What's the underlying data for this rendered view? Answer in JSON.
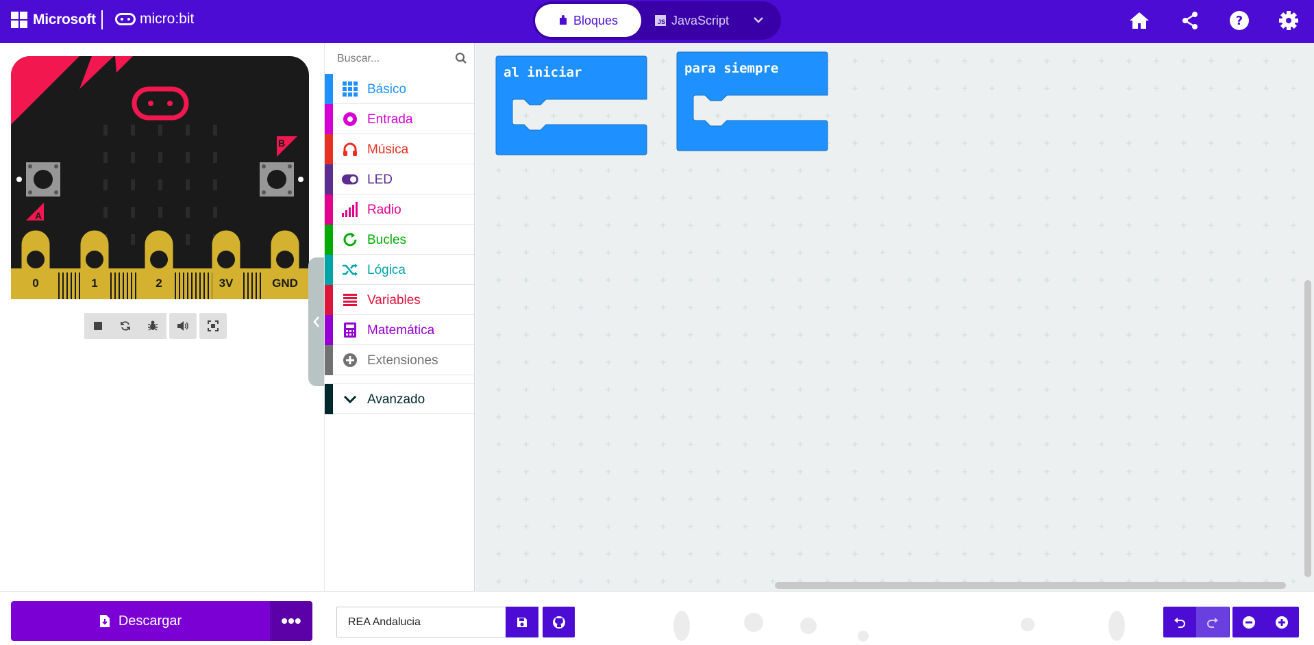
{
  "header": {
    "brand": "Microsoft",
    "product": "micro:bit",
    "tabs": [
      {
        "label": "Bloques",
        "active": true
      },
      {
        "label": "JavaScript",
        "active": false
      }
    ],
    "js_badge": "JS",
    "icons": [
      "home-icon",
      "share-icon",
      "help-icon",
      "settings-icon"
    ]
  },
  "simulator": {
    "pins": [
      "0",
      "1",
      "2",
      "3V",
      "GND"
    ],
    "button_a": "A",
    "button_b": "B",
    "toolbar_icons": [
      "stop-icon",
      "restart-icon",
      "debug-icon",
      "sound-icon",
      "fullscreen-icon"
    ]
  },
  "toolbox": {
    "search_placeholder": "Buscar...",
    "categories": [
      {
        "label": "Básico",
        "color": "#1e90ff",
        "icon": "grid-icon"
      },
      {
        "label": "Entrada",
        "color": "#d400d4",
        "icon": "target-icon"
      },
      {
        "label": "Música",
        "color": "#e63022",
        "icon": "headphones-icon"
      },
      {
        "label": "LED",
        "color": "#5c2d91",
        "icon": "toggle-icon"
      },
      {
        "label": "Radio",
        "color": "#e3008c",
        "icon": "signal-icon"
      },
      {
        "label": "Bucles",
        "color": "#00aa00",
        "icon": "loop-icon"
      },
      {
        "label": "Lógica",
        "color": "#00a4a6",
        "icon": "shuffle-icon"
      },
      {
        "label": "Variables",
        "color": "#dc143c",
        "icon": "list-icon"
      },
      {
        "label": "Matemática",
        "color": "#9400d3",
        "icon": "calculator-icon"
      },
      {
        "label": "Extensiones",
        "color": "#717171",
        "icon": "plus-circle-icon"
      },
      {
        "label": "Avanzado",
        "color": "#00272b",
        "icon": "chevron-down-icon"
      }
    ]
  },
  "workspace": {
    "blocks": [
      {
        "label": "al iniciar"
      },
      {
        "label": "para siempre"
      }
    ],
    "block_color": "#1e90ff"
  },
  "footer": {
    "download_label": "Descargar",
    "more_label": "•••",
    "project_name": "REA Andalucia"
  },
  "colors": {
    "header": "#4c0cd4",
    "download": "#7a00d4",
    "workspace": "#ecf0f1"
  }
}
